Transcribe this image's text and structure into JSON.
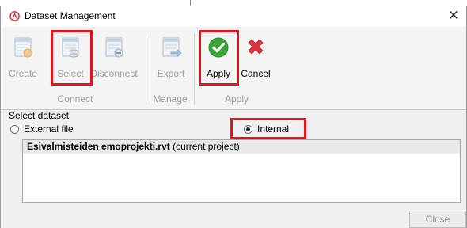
{
  "window": {
    "title": "Dataset Management",
    "close_glyph": "✕"
  },
  "ribbon": {
    "buttons": [
      {
        "label": "Create",
        "icon": "create-dataset-icon",
        "enabled": false
      },
      {
        "label": "Select",
        "icon": "select-dataset-icon",
        "enabled": false
      },
      {
        "label": "Disconnect",
        "icon": "disconnect-dataset-icon",
        "enabled": false
      },
      {
        "label": "Export",
        "icon": "export-dataset-icon",
        "enabled": false
      },
      {
        "label": "Apply",
        "icon": "check-icon",
        "enabled": true,
        "color": "#3aa537"
      },
      {
        "label": "Cancel",
        "icon": "cancel-x-icon",
        "enabled": true,
        "color": "#e0343c"
      }
    ],
    "groups": [
      "Connect",
      "Manage",
      "Apply"
    ]
  },
  "dataset": {
    "section_label": "Select dataset",
    "options": [
      {
        "label": "External file",
        "selected": false
      },
      {
        "label": "Internal",
        "selected": true
      }
    ],
    "rows": [
      {
        "name": "Esivalmisteiden emoprojekti.rvt",
        "note": "(current project)"
      }
    ]
  },
  "footer": {
    "close_label": "Close"
  },
  "colors": {
    "highlight": "#e3141e",
    "disabled_text": "#9c9c9c",
    "apply_green": "#3aa537",
    "cancel_red": "#e0343c"
  }
}
